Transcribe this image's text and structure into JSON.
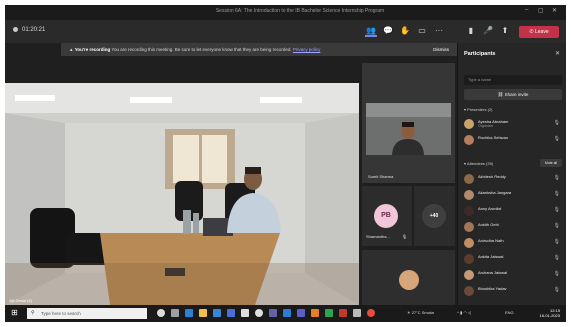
{
  "window": {
    "title": "Session 6A: The Introduction to the IB Bachelor Science Internship Program"
  },
  "toolbar": {
    "timer": "01:20:21",
    "leave_label": "Leave"
  },
  "banner": {
    "headline": "You're recording",
    "message": "You are recording this meeting. Be sure to let everyone know that they are being recorded.",
    "link": "Privacy policy",
    "dismiss": "Dismiss"
  },
  "tiles": {
    "presenter_name": "Sumit Sharma",
    "pb_initials": "PB",
    "pb_name": "Shamantha...",
    "more_label": "+40"
  },
  "main": {
    "caption": "Ajit Desai (4)"
  },
  "participants": {
    "title": "Participants",
    "search_placeholder": "Type a name",
    "share_label": "Share invite",
    "presenters_heading": "Presenters (2)",
    "attendees_heading": "Attendees (39)",
    "mute_all_label": "Mute all",
    "presenters": [
      {
        "name": "Ayesha Abraham",
        "role": "Organizer",
        "color": "#c9a36a"
      },
      {
        "name": "Ruchika Sehwan",
        "role": "",
        "color": "#b57d5b"
      }
    ],
    "attendees": [
      {
        "name": "Akhilesh Reddy",
        "color": "#8b6a4a"
      },
      {
        "name": "Akanksha Jangara",
        "color": "#b08a6b"
      },
      {
        "name": "Anny Arunlist",
        "color": "#3c2a2a"
      },
      {
        "name": "Ankith Gehl",
        "color": "#a27657"
      },
      {
        "name": "Anirudha Nath",
        "color": "#c48c62"
      },
      {
        "name": "Ankita Jaiswal",
        "color": "#5e3b2f"
      },
      {
        "name": "Archana Jaiswal",
        "color": "#c79a77"
      },
      {
        "name": "Bhoshika Yadav",
        "color": "#6b4a3a"
      }
    ]
  },
  "taskbar": {
    "search_placeholder": "Type here to search",
    "weather": "27°C Smoke",
    "lang": "ENG",
    "time": "12:15",
    "date": "16-01-2023"
  }
}
